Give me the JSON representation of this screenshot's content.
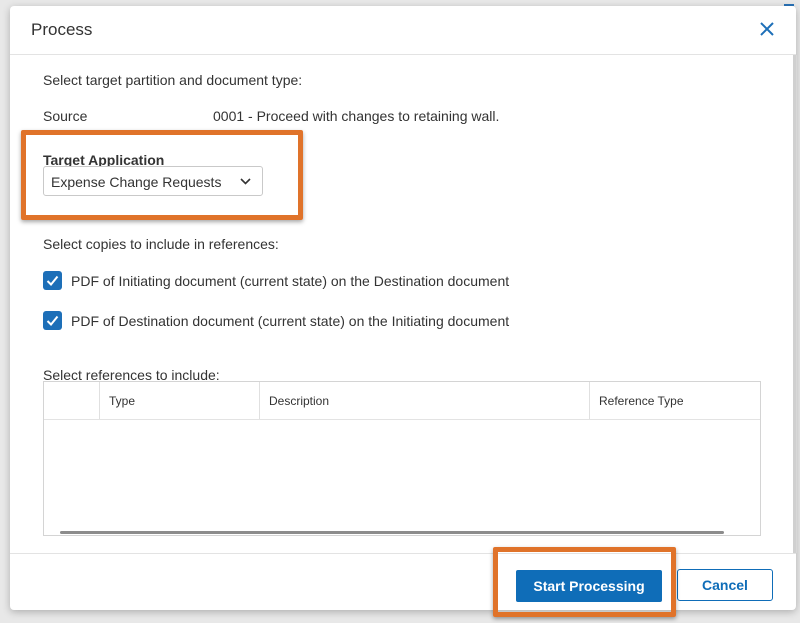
{
  "colors": {
    "accent": "#0f6db8",
    "highlight": "#e0732a",
    "checkbox": "#1d6fb8"
  },
  "dialog": {
    "title": "Process",
    "close_icon": "close-icon"
  },
  "form": {
    "intro": "Select target partition and document type:",
    "source_label": "Source",
    "source_value": "0001 - Proceed with changes to retaining wall.",
    "target_label": "Target Application",
    "target_value": "Expense Change Requests",
    "copies_label": "Select copies to include in references:",
    "checkboxes": [
      {
        "label": "PDF of Initiating document (current state) on the Destination document",
        "checked": true
      },
      {
        "label": "PDF of Destination document (current state) on the Initiating document",
        "checked": true
      }
    ],
    "references_label": "Select references to include:"
  },
  "table": {
    "columns": [
      "",
      "Type",
      "Description",
      "Reference Type"
    ],
    "rows": []
  },
  "footer": {
    "primary_label": "Start Processing",
    "secondary_label": "Cancel"
  }
}
